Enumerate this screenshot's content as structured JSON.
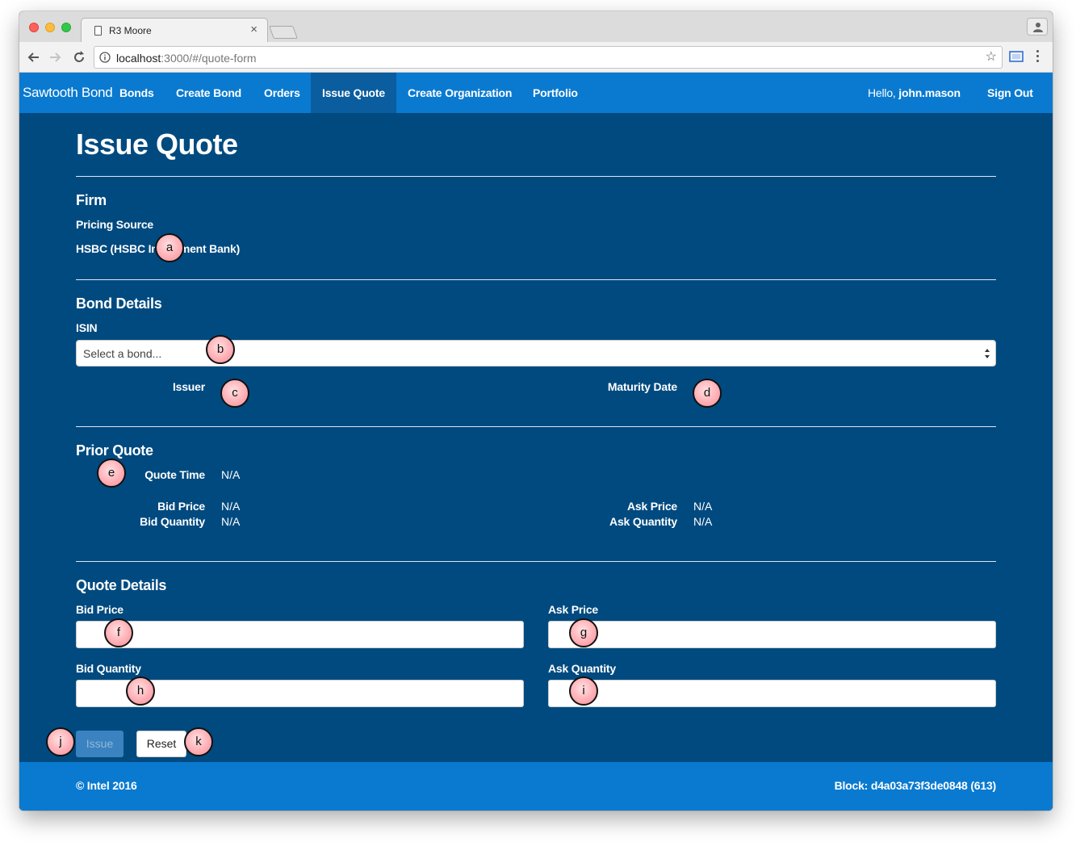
{
  "browser": {
    "tab_title": "R3 Moore",
    "tab_close": "×",
    "url_host": "localhost",
    "url_path": ":3000/#/quote-form"
  },
  "navbar": {
    "brand": "Sawtooth Bond",
    "items": [
      {
        "label": "Bonds"
      },
      {
        "label": "Create Bond"
      },
      {
        "label": "Orders"
      },
      {
        "label": "Issue Quote",
        "active": true
      },
      {
        "label": "Create Organization"
      },
      {
        "label": "Portfolio"
      }
    ],
    "greeting": "Hello,",
    "username": "john.mason",
    "sign_out": "Sign Out"
  },
  "page": {
    "title": "Issue Quote",
    "firm": {
      "heading": "Firm",
      "pricing_source_label": "Pricing Source",
      "pricing_source_value": "HSBC (HSBC Investment Bank)"
    },
    "bond_details": {
      "heading": "Bond Details",
      "isin_label": "ISIN",
      "isin_placeholder": "Select a bond...",
      "issuer_label": "Issuer",
      "issuer_value": "",
      "maturity_label": "Maturity Date",
      "maturity_value": ""
    },
    "prior_quote": {
      "heading": "Prior Quote",
      "quote_time_label": "Quote Time",
      "quote_time_value": "N/A",
      "bid_price_label": "Bid Price",
      "bid_price_value": "N/A",
      "bid_quantity_label": "Bid Quantity",
      "bid_quantity_value": "N/A",
      "ask_price_label": "Ask Price",
      "ask_price_value": "N/A",
      "ask_quantity_label": "Ask Quantity",
      "ask_quantity_value": "N/A"
    },
    "quote_details": {
      "heading": "Quote Details",
      "bid_price_label": "Bid Price",
      "bid_price_value": "",
      "ask_price_label": "Ask Price",
      "ask_price_value": "",
      "bid_quantity_label": "Bid Quantity",
      "bid_quantity_value": "",
      "ask_quantity_label": "Ask Quantity",
      "ask_quantity_value": ""
    },
    "issue_button": "Issue",
    "reset_button": "Reset"
  },
  "footer": {
    "copyright": "© Intel 2016",
    "block": "Block: d4a03a73f3de0848 (613)"
  },
  "markers": [
    "a",
    "b",
    "c",
    "d",
    "e",
    "f",
    "g",
    "h",
    "i",
    "j",
    "k"
  ],
  "colors": {
    "navbar": "#0a7ad0",
    "nav_active": "#0a5d9e",
    "page_background": "#004a80",
    "footer": "#0a7ad0",
    "marker_fill": "#ffb0b6"
  }
}
